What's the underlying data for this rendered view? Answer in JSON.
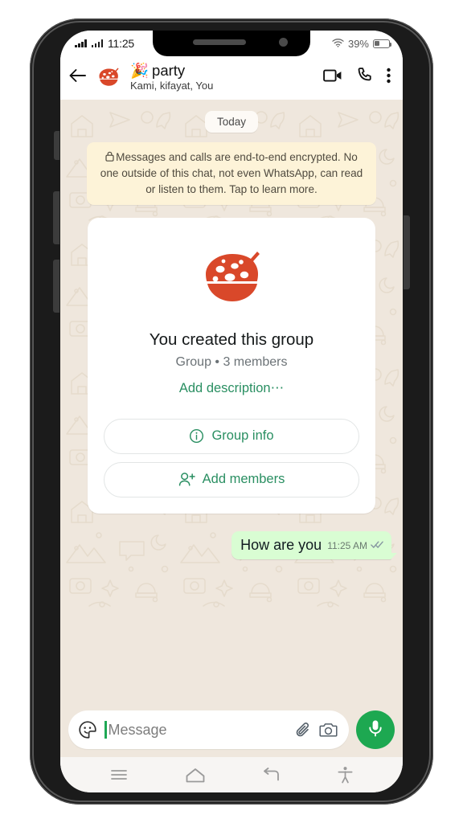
{
  "status_bar": {
    "time": "11:25",
    "signal_icon": "signal-bars-icon",
    "signal_icon_2": "signal-bars-icon",
    "wifi_icon": "wifi-icon",
    "battery_percent": "39%",
    "battery_icon": "battery-icon",
    "battery_level": 39
  },
  "header": {
    "back_icon": "back-arrow-icon",
    "avatar_icon": "group-avatar-pizza-icon",
    "title": "🎉 party",
    "title_emoji": "🎉",
    "title_text": "party",
    "subtitle": "Kami, kifayat, You",
    "video_call_icon": "video-call-icon",
    "voice_call_icon": "phone-call-icon",
    "overflow_icon": "more-vertical-icon"
  },
  "chat": {
    "date_divider": "Today",
    "encryption_notice": "Messages and calls are end-to-end encrypted. No one outside of this chat, not even WhatsApp, can read or listen to them. Tap to learn more.",
    "lock_icon": "lock-icon",
    "group_card": {
      "avatar_icon": "group-avatar-pizza-icon",
      "title": "You created this group",
      "meta": "Group • 3 members",
      "add_description_label": "Add description⋯",
      "buttons": [
        {
          "label": "Group info",
          "icon": "info-circle-icon"
        },
        {
          "label": "Add members",
          "icon": "person-add-icon"
        }
      ]
    },
    "messages": [
      {
        "text": "How are you",
        "time": "11:25 AM",
        "status_icon": "double-check-icon",
        "direction": "outgoing"
      }
    ]
  },
  "input_bar": {
    "emoji_icon": "sticker-emoji-icon",
    "placeholder": "Message",
    "value": "",
    "attach_icon": "paperclip-icon",
    "camera_icon": "camera-icon",
    "mic_icon": "microphone-icon"
  },
  "nav_bar": {
    "items": [
      {
        "icon": "recents-menu-icon"
      },
      {
        "icon": "home-icon"
      },
      {
        "icon": "back-nav-icon"
      },
      {
        "icon": "accessibility-icon"
      }
    ]
  },
  "colors": {
    "brand_green": "#1da851",
    "link_green": "#2a8f62",
    "bubble_out": "#d9fdd3",
    "wallpaper": "#efe7dd",
    "encryption_bg": "#fdf3d8",
    "avatar_orange": "#d9482a"
  }
}
